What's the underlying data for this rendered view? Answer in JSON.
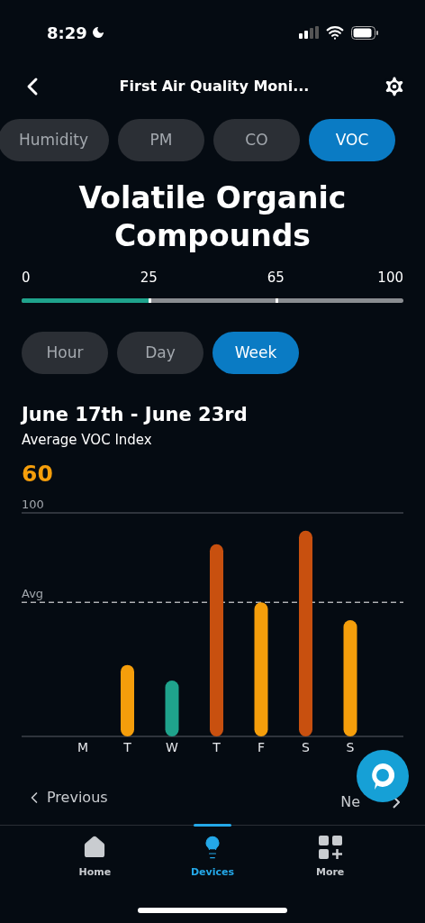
{
  "status_bar": {
    "time": "8:29"
  },
  "header": {
    "title": "First Air Quality Moni..."
  },
  "sensor_tabs": [
    {
      "label": "Humidity",
      "selected": false
    },
    {
      "label": "PM",
      "selected": false
    },
    {
      "label": "CO",
      "selected": false
    },
    {
      "label": "VOC",
      "selected": true
    }
  ],
  "heading": "Volatile Organic Compounds",
  "scale": {
    "labels": [
      "0",
      "25",
      "65",
      "100"
    ],
    "level": 0.333
  },
  "range_tabs": [
    {
      "label": "Hour",
      "selected": false
    },
    {
      "label": "Day",
      "selected": false
    },
    {
      "label": "Week",
      "selected": true
    }
  ],
  "period": {
    "title": "June 17th - June 23rd",
    "subtitle": "Average VOC Index",
    "value": "60"
  },
  "chart": {
    "top_label": "100",
    "average_label": "Avg",
    "days": [
      "M",
      "T",
      "W",
      "T",
      "F",
      "S",
      "S"
    ]
  },
  "pager": {
    "previous": "Previous",
    "next": "Ne"
  },
  "bottom_nav": [
    {
      "label": "Home",
      "selected": false
    },
    {
      "label": "Devices",
      "selected": true
    },
    {
      "label": "More",
      "selected": false
    }
  ]
}
